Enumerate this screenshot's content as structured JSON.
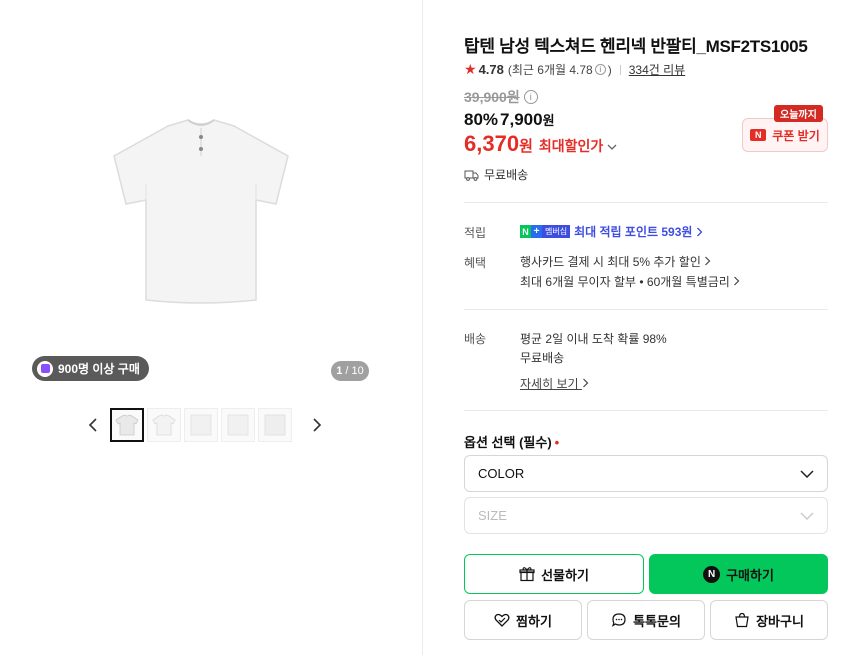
{
  "gallery": {
    "buyers_badge": "900명 이상 구매",
    "counter_current": "1",
    "counter_total": "/ 10",
    "thumbnail_count": 5
  },
  "product": {
    "title": "탑텐 남성 텍스쳐드 헨리넥 반팔티_MSF2TS1005",
    "rating": "4.78",
    "recent_rating": "(최근 6개월 4.78",
    "recent_close": ")",
    "review_link": "334건 리뷰",
    "original_price": "39,900원",
    "discount_rate": "80%",
    "sale_price": "7,900",
    "sale_unit": "원",
    "max_discount_price": "6,370",
    "max_discount_unit": "원",
    "max_discount_label": "최대할인가",
    "coupon_tag": "오늘까지",
    "coupon_button": "쿠폰 받기",
    "free_shipping": "무료배송"
  },
  "points": {
    "label": "적립",
    "badge_n": "N",
    "badge_plus": "+",
    "badge_member": "멤버십",
    "link": "최대 적립 포인트 593원"
  },
  "benefits": {
    "label": "혜택",
    "line1": "행사카드 결제 시 최대 5% 추가 할인",
    "line2": "최대 6개월 무이자 할부 • 60개월 특별금리"
  },
  "shipping": {
    "label": "배송",
    "line1": "평균 2일 이내 도착 확률 98%",
    "line2": "무료배송",
    "more": "자세히 보기"
  },
  "options": {
    "title": "옵션 선택 (필수)",
    "required_mark": "•",
    "color_label": "COLOR",
    "size_label": "SIZE"
  },
  "actions": {
    "gift": "선물하기",
    "buy": "구매하기",
    "buy_logo": "N",
    "wish": "찜하기",
    "talk": "톡톡문의",
    "cart": "장바구니"
  },
  "colors": {
    "accent_red": "#e52d27",
    "naver_green": "#03c75a",
    "membership_blue": "#3d4de0"
  }
}
